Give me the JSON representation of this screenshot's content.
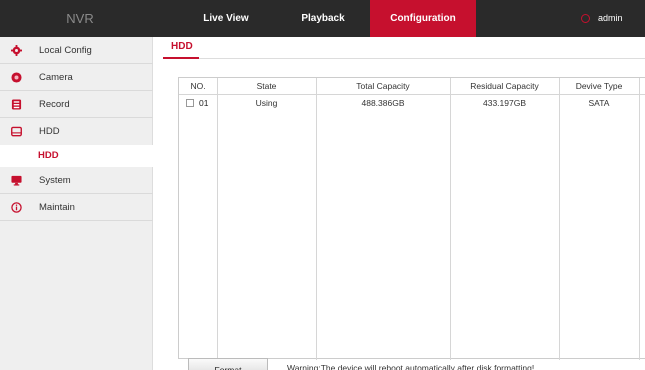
{
  "header": {
    "brand": "NVR",
    "tabs": [
      {
        "label": "Live View"
      },
      {
        "label": "Playback"
      },
      {
        "label": "Configuration"
      }
    ],
    "active_tab": "Configuration",
    "user": "admin"
  },
  "sidebar": {
    "items": [
      {
        "label": "Local Config",
        "icon": "gear-icon"
      },
      {
        "label": "Camera",
        "icon": "camera-icon"
      },
      {
        "label": "Record",
        "icon": "record-icon"
      },
      {
        "label": "HDD",
        "icon": "hdd-icon"
      },
      {
        "label": "System",
        "icon": "monitor-icon"
      },
      {
        "label": "Maintain",
        "icon": "info-icon"
      }
    ],
    "subitem": "HDD"
  },
  "main": {
    "title": "HDD",
    "table": {
      "columns": [
        "NO.",
        "State",
        "Total Capacity",
        "Residual Capacity",
        "Devive Type"
      ],
      "rows": [
        {
          "no": "01",
          "state": "Using",
          "total": "488.386GB",
          "residual": "433.197GB",
          "type": "SATA"
        }
      ]
    },
    "format_button": "Format",
    "warning": "Warning:The device will reboot automatically after disk formatting!"
  },
  "colors": {
    "accent": "#c6102e",
    "topbar": "#2a2a2a",
    "sidebar": "#efefef"
  }
}
